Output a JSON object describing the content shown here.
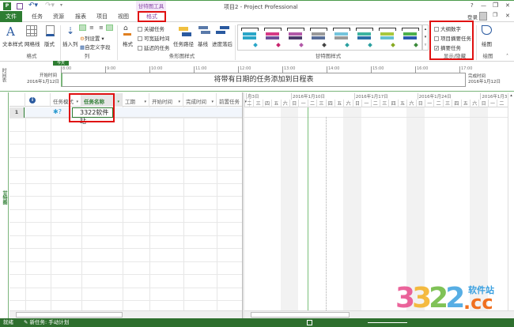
{
  "titlebar": {
    "title": "项目2 - Project Professional",
    "context_tab": "甘特图工具",
    "help": "?",
    "minimize": "—",
    "restore": "❐",
    "close": "✕",
    "login": "登录"
  },
  "tabs": [
    {
      "label": "文件"
    },
    {
      "label": "任务"
    },
    {
      "label": "资源"
    },
    {
      "label": "报表"
    },
    {
      "label": "项目"
    },
    {
      "label": "视图"
    },
    {
      "label": "格式"
    }
  ],
  "ribbon": {
    "format_group": {
      "label": "格式",
      "text_styles": "文本样式",
      "gridlines": "网格线",
      "layout": "版式"
    },
    "columns_group": {
      "label": "列",
      "insert_column": "插入列",
      "column_settings": "列设置",
      "custom_fields": "自定义字段"
    },
    "bar_styles_group": {
      "label": "条形图样式",
      "format": "格式",
      "critical_tasks": "关键任务",
      "slack": "可宽延时间",
      "late_tasks": "延迟的任务",
      "task_path": "任务路径",
      "baseline": "基线",
      "slippage": "进度落后"
    },
    "gantt_styles_group": {
      "label": "甘特图样式",
      "colors": [
        [
          "#2aa6c8",
          "#2aa6c8"
        ],
        [
          "#d63a86",
          "#6d4f9a"
        ],
        [
          "#b259a8",
          "#4b3a6a"
        ],
        [
          "#9a9a9a",
          "#5a6f9a"
        ],
        [
          "#74c4dc",
          "#9a9a9a"
        ],
        [
          "#3cb4a0",
          "#2a6fa8"
        ],
        [
          "#a8c83c",
          "#66c0d0"
        ],
        [
          "#4cb04c",
          "#2a5ab0"
        ]
      ],
      "diamonds": [
        "#2aa6c8",
        "#c8246e",
        "#b259a8",
        "#444444",
        "#2aa0a0",
        "#2aa0a0",
        "#88aa22",
        "#3a8a3a"
      ]
    },
    "show_hide_group": {
      "label": "显示/隐藏",
      "outline_number": "大纲数字",
      "project_summary": "项目摘要任务",
      "summary_tasks": "摘要任务",
      "summary_checked": true
    },
    "drawings_group": {
      "label": "绘图",
      "drawing": "绘图"
    }
  },
  "timeline": {
    "side_label": "时间表",
    "today": "今天",
    "start_label": "开始时间",
    "start_date": "2016年1月12日",
    "finish_label": "完成时间",
    "finish_date": "2016年1月12日",
    "ticks": [
      "8:00",
      "9:00",
      "10:00",
      "11:00",
      "12:00",
      "13:00",
      "14:00",
      "15:00",
      "16:00",
      "17:00"
    ],
    "placeholder": "将带有日期的任务添加到日程表"
  },
  "grid": {
    "view_label": "甘特图",
    "columns": [
      "任务模式",
      "任务名称",
      "工期",
      "开始时间",
      "完成时间",
      "前置任务"
    ],
    "rows": [
      {
        "id": "1",
        "name": "3322软件站"
      }
    ]
  },
  "gantt": {
    "weeks": [
      "月3日",
      "2016年1月10日",
      "2016年1月17日",
      "2016年1月24日",
      "2016年1月31日"
    ],
    "days": [
      "二",
      "三",
      "四",
      "五",
      "六",
      "日",
      "一",
      "二",
      "三",
      "四",
      "五",
      "六",
      "日",
      "一",
      "二",
      "三",
      "四",
      "五",
      "六",
      "日",
      "一",
      "二",
      "三",
      "四",
      "五",
      "六",
      "日",
      "一",
      "二"
    ]
  },
  "status": {
    "ready": "就绪",
    "new_tasks": "新任务: 手动计划"
  },
  "watermark": {
    "text": "3322软件站",
    "domain": ".cc"
  }
}
